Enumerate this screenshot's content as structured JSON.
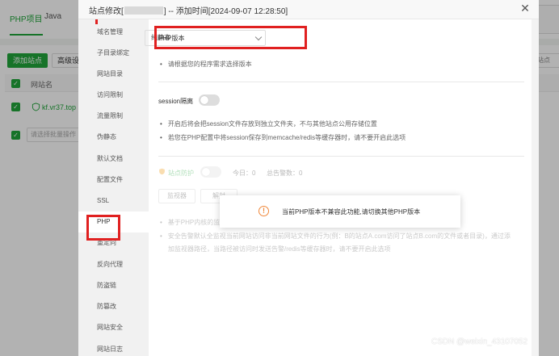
{
  "background": {
    "tabs": [
      {
        "label": "PHP项目"
      },
      {
        "label": "Java"
      }
    ],
    "add_site_label": "添加站点",
    "advanced_label": "高级设",
    "table_header_site": "网站名",
    "site_row_name": "kf.vr37.top",
    "batch_placeholder": "请选择批量操作",
    "right_button_label": "站点",
    "accent_color": "#20a53a"
  },
  "dialog": {
    "title_prefix": "站点修改[",
    "title_suffix": "] -- 添加时间[2024-09-07 12:28:50]",
    "close_label": "✕",
    "nav_items": [
      {
        "label": "域名管理"
      },
      {
        "label": "子目录绑定"
      },
      {
        "label": "网站目录"
      },
      {
        "label": "访问限制"
      },
      {
        "label": "流量限制"
      },
      {
        "label": "伪静态"
      },
      {
        "label": "默认文档"
      },
      {
        "label": "配置文件"
      },
      {
        "label": "SSL"
      },
      {
        "label": "PHP"
      },
      {
        "label": "重定向"
      },
      {
        "label": "反向代理"
      },
      {
        "label": "防盗链"
      },
      {
        "label": "防篡改"
      },
      {
        "label": "网站安全"
      },
      {
        "label": "网站日志"
      }
    ],
    "active_nav": "PHP",
    "php": {
      "version_label": "PHP版本",
      "version_value": "纯静态",
      "version_tip": "请根据您的程序需求选择版本"
    },
    "session": {
      "label": "session隔离",
      "enabled": false,
      "tips": [
        "开启后将会把session文件存放到独立文件夹，不与其他站点公用存储位置",
        "若您在PHP配置中将session保存到memcache/redis等缓存器时，请不要开启此选项"
      ]
    },
    "protect": {
      "label": "站点防护",
      "enabled": false,
      "today_label": "今日：0",
      "total_label": "总告警数：0",
      "monitor_button": "监视器",
      "second_button": "解封",
      "tips": [
        "基于PHP内核的监",
        "安全告警默认全监视当前网站访问非当前网站文件的行为(例：B的站点A.com访问了站点B.com的文件或者目录)，通过添",
        "加监视器路径，当路径被访问时发送告警/redis等缓存器时，请不要开启此选项"
      ]
    }
  },
  "toast": {
    "message": "当前PHP版本不兼容此功能,请切换其他PHP版本",
    "icon": "warning-icon"
  },
  "watermark": "CSDN @weixin_43107052"
}
